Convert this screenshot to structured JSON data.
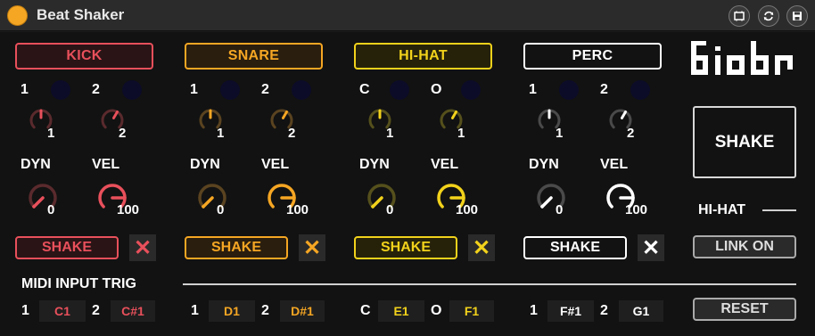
{
  "window": {
    "title": "Beat Shaker"
  },
  "colors": {
    "kick": "#e8505b",
    "snare": "#f5a623",
    "hihat": "#f2d21b",
    "perc": "#ffffff"
  },
  "instruments": [
    {
      "key": "kick",
      "label": "KICK",
      "sub1": "1",
      "sub2": "2",
      "pitch1": "1",
      "pitch2": "2",
      "dyn_label": "DYN",
      "vel_label": "VEL",
      "dyn_value": "0",
      "vel_value": "100",
      "shake_label": "SHAKE",
      "close_glyph": "✕",
      "midi_label1": "1",
      "midi_note1": "C1",
      "midi_label2": "2",
      "midi_note2": "C#1"
    },
    {
      "key": "snare",
      "label": "SNARE",
      "sub1": "1",
      "sub2": "2",
      "pitch1": "1",
      "pitch2": "2",
      "dyn_label": "DYN",
      "vel_label": "VEL",
      "dyn_value": "0",
      "vel_value": "100",
      "shake_label": "SHAKE",
      "close_glyph": "✕",
      "midi_label1": "1",
      "midi_note1": "D1",
      "midi_label2": "2",
      "midi_note2": "D#1"
    },
    {
      "key": "hihat",
      "label": "HI-HAT",
      "sub1": "C",
      "sub2": "O",
      "pitch1": "1",
      "pitch2": "1",
      "dyn_label": "DYN",
      "vel_label": "VEL",
      "dyn_value": "0",
      "vel_value": "100",
      "shake_label": "SHAKE",
      "close_glyph": "✕",
      "midi_label1": "C",
      "midi_note1": "E1",
      "midi_label2": "O",
      "midi_note2": "F1"
    },
    {
      "key": "perc",
      "label": "PERC",
      "sub1": "1",
      "sub2": "2",
      "pitch1": "1",
      "pitch2": "2",
      "dyn_label": "DYN",
      "vel_label": "VEL",
      "dyn_value": "0",
      "vel_value": "100",
      "shake_label": "SHAKE",
      "close_glyph": "✕",
      "midi_label1": "1",
      "midi_note1": "F#1",
      "midi_label2": "2",
      "midi_note2": "G1"
    }
  ],
  "midi": {
    "title": "MIDI INPUT TRIG"
  },
  "right": {
    "shake_label": "SHAKE",
    "link_target": "HI-HAT",
    "link_button": "LINK ON",
    "reset_button": "RESET"
  },
  "icons": {
    "title_buttons": [
      "window-icon",
      "refresh-icon",
      "save-icon"
    ],
    "logo": "biobi-logo"
  }
}
